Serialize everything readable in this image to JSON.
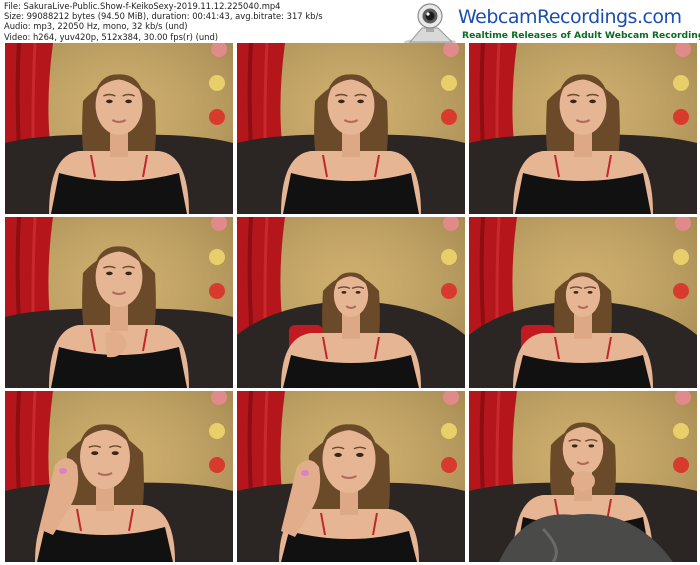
{
  "meta": {
    "file": "File: SakuraLive-Public.Show-f-KeikoSexy-2019.11.12.225040.mp4",
    "size": "Size: 99088212 bytes (94.50 MiB), duration: 00:41:43, avg.bitrate: 317 kb/s",
    "audio": "Audio: mp3, 22050 Hz, mono, 32 kb/s (und)",
    "video": "Video: h264, yuv420p, 512x384, 30.00 fps(r) (und)"
  },
  "logo": {
    "brand": "WebcamRecordings.com",
    "tagline": "Realtime Releases of Adult Webcam Recordings"
  },
  "colors": {
    "wall": "#c8a45a",
    "curtain": "#b5161c",
    "sofa": "#2b2624",
    "hair": "#6b4a2a",
    "skin": "#e6b594",
    "top": "#121112",
    "pillow": "#c21a22"
  },
  "thumbnails": [
    {
      "variant": "couch-wide"
    },
    {
      "variant": "couch-wide"
    },
    {
      "variant": "couch-wide"
    },
    {
      "variant": "hand-chest"
    },
    {
      "variant": "far-pillow"
    },
    {
      "variant": "far-pillow"
    },
    {
      "variant": "hand-face"
    },
    {
      "variant": "hand-face-close"
    },
    {
      "variant": "blanket"
    }
  ]
}
